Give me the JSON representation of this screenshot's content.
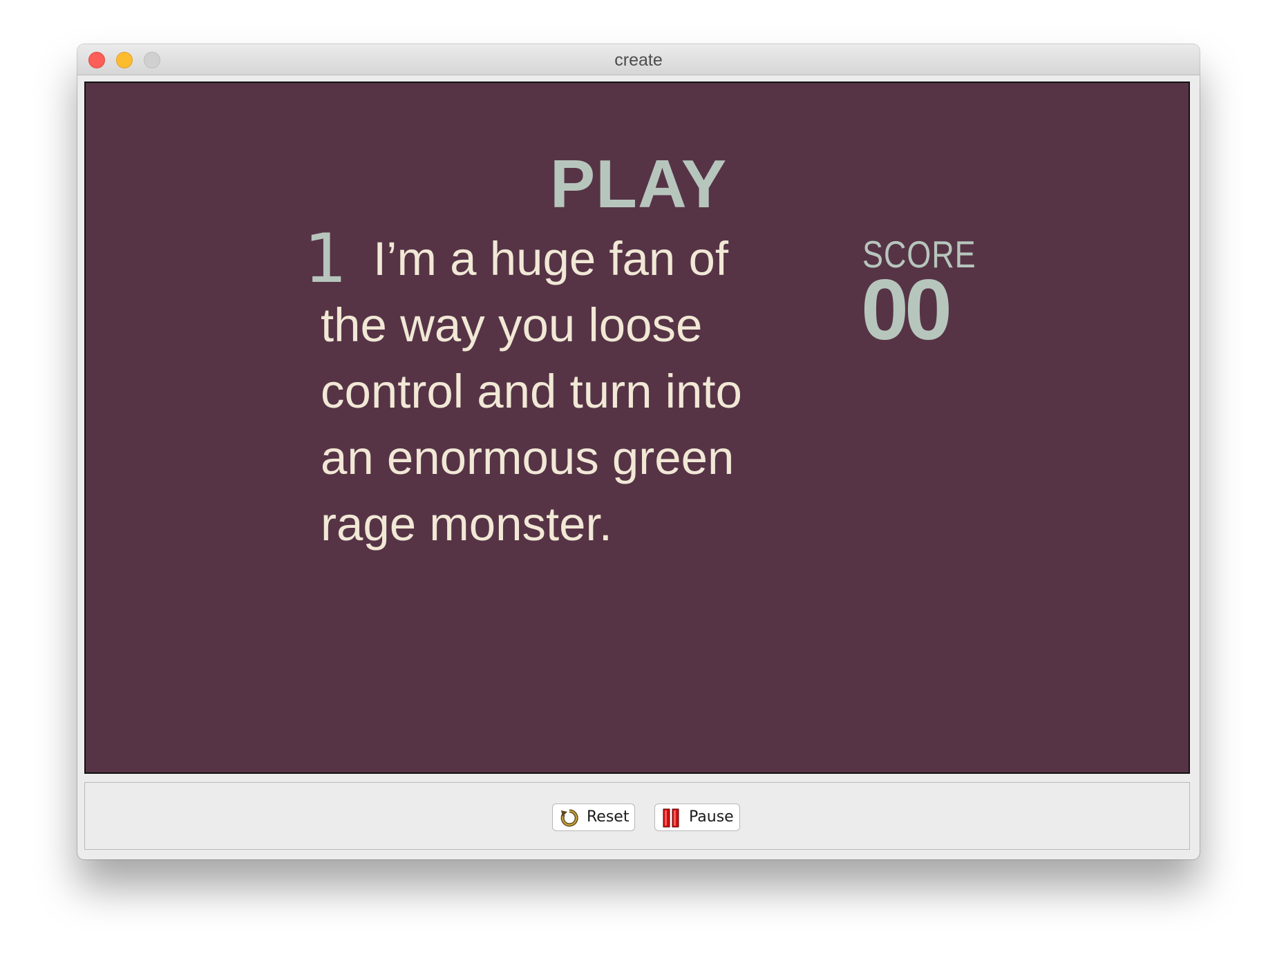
{
  "window": {
    "title": "create"
  },
  "game": {
    "heading": "PLAY",
    "question_number": "1",
    "question_text": "I’m a huge fan of the way you loose control and turn into an enormous green rage monster.",
    "score_label": "SCORE",
    "score_value": "00"
  },
  "controls": {
    "reset_label": "Reset",
    "reset_icon": "reset-icon",
    "pause_label": "Pause",
    "pause_icon": "pause-icon"
  },
  "colors": {
    "canvas_background": "#563446",
    "accent_text": "#b7c6bd",
    "question_text": "#f1e8d6"
  }
}
